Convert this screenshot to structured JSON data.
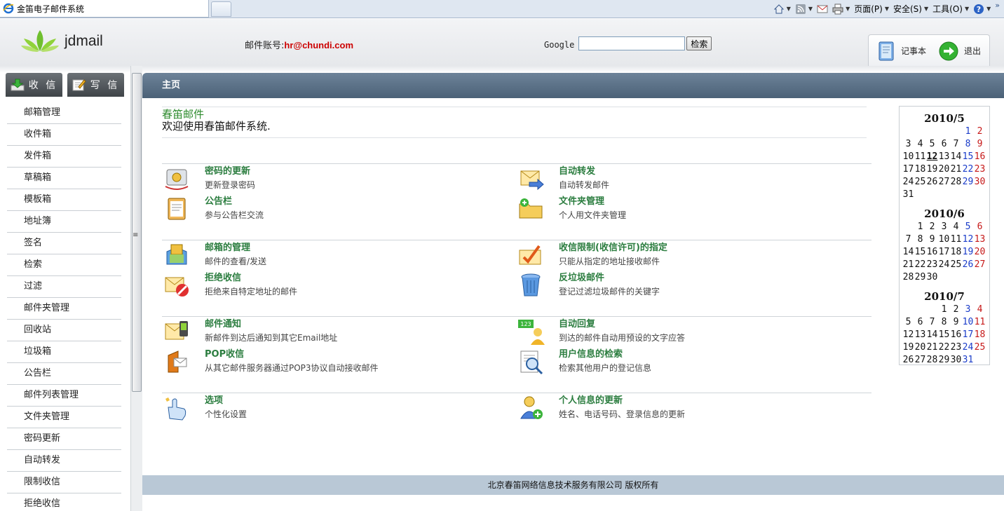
{
  "browser": {
    "tab_title": "金笛电子邮件系统",
    "menu": {
      "page": "页面(P)",
      "safety": "安全(S)",
      "tools": "工具(O)"
    }
  },
  "header": {
    "logo_text": "jdmail",
    "account_label": "邮件账号:",
    "account_value": "hr@chundi.com",
    "google_label": "Google",
    "search_value": "",
    "search_button": "检索",
    "notepad": "记事本",
    "logout": "退出"
  },
  "sidebar": {
    "receive": "收 信",
    "compose": "写 信",
    "items": [
      "邮箱管理",
      "收件箱",
      "发件箱",
      "草稿箱",
      "模板箱",
      "地址簿",
      "签名",
      "检索",
      "过滤",
      "邮件夹管理",
      "回收站",
      "垃圾箱",
      "公告栏",
      "邮件列表管理",
      "文件夹管理",
      "密码更新",
      "自动转发",
      "限制收信",
      "拒绝收信"
    ]
  },
  "main": {
    "title": "主页",
    "welcome_name": "春笛邮件",
    "welcome_msg": "欢迎使用春笛邮件系统.",
    "features": [
      {
        "title": "密码的更新",
        "desc": "更新登录密码",
        "icon": "password-update-icon"
      },
      {
        "title": "自动转发",
        "desc": "自动转发邮件",
        "icon": "auto-forward-icon"
      },
      {
        "title": "公告栏",
        "desc": "参与公告栏交流",
        "icon": "bulletin-board-icon"
      },
      {
        "title": "文件夹管理",
        "desc": "个人用文件夹管理",
        "icon": "folder-management-icon"
      },
      {
        "title": "邮箱的管理",
        "desc": "邮件的查看/发送",
        "icon": "mailbox-management-icon"
      },
      {
        "title": "收信限制(收信许可)的指定",
        "desc": "只能从指定的地址接收邮件",
        "icon": "receive-restriction-icon"
      },
      {
        "title": "拒绝收信",
        "desc": "拒绝来自特定地址的邮件",
        "icon": "reject-mail-icon"
      },
      {
        "title": "反垃圾邮件",
        "desc": "登记过滤垃圾邮件的关键字",
        "icon": "trash-can-icon"
      },
      {
        "title": "邮件通知",
        "desc": "新邮件到达后通知到其它Email地址",
        "icon": "mail-notification-icon"
      },
      {
        "title": "自动回复",
        "desc": "到达的邮件自动用预设的文字应答",
        "icon": "auto-reply-icon"
      },
      {
        "title": "POP收信",
        "desc": "从其它邮件服务器通过POP3协议自动接收邮件",
        "icon": "pop-receive-icon"
      },
      {
        "title": "用户信息的检索",
        "desc": "检索其他用户的登记信息",
        "icon": "user-search-icon"
      },
      {
        "title": "选项",
        "desc": "个性化设置",
        "icon": "options-hand-icon"
      },
      {
        "title": "个人信息的更新",
        "desc": "姓名、电话号码、登录信息的更新",
        "icon": "personal-info-icon"
      }
    ],
    "footer": "北京春笛网络信息技术服务有限公司  版权所有"
  },
  "calendar": {
    "months": [
      {
        "title": "2010/5",
        "weeks": [
          [
            "",
            "",
            "",
            "",
            "",
            "1",
            "2"
          ],
          [
            "3",
            "4",
            "5",
            "6",
            "7",
            "8",
            "9"
          ],
          [
            "10",
            "11",
            "12",
            "13",
            "14",
            "15",
            "16"
          ],
          [
            "17",
            "18",
            "19",
            "20",
            "21",
            "22",
            "23"
          ],
          [
            "24",
            "25",
            "26",
            "27",
            "28",
            "29",
            "30"
          ],
          [
            "31",
            "",
            "",
            "",
            "",
            "",
            ""
          ]
        ],
        "today": "12"
      },
      {
        "title": "2010/6",
        "weeks": [
          [
            "",
            "1",
            "2",
            "3",
            "4",
            "5",
            "6"
          ],
          [
            "7",
            "8",
            "9",
            "10",
            "11",
            "12",
            "13"
          ],
          [
            "14",
            "15",
            "16",
            "17",
            "18",
            "19",
            "20"
          ],
          [
            "21",
            "22",
            "23",
            "24",
            "25",
            "26",
            "27"
          ],
          [
            "28",
            "29",
            "30",
            "",
            "",
            "",
            ""
          ]
        ]
      },
      {
        "title": "2010/7",
        "weeks": [
          [
            "",
            "",
            "",
            "1",
            "2",
            "3",
            "4"
          ],
          [
            "5",
            "6",
            "7",
            "8",
            "9",
            "10",
            "11"
          ],
          [
            "12",
            "13",
            "14",
            "15",
            "16",
            "17",
            "18"
          ],
          [
            "19",
            "20",
            "21",
            "22",
            "23",
            "24",
            "25"
          ],
          [
            "26",
            "27",
            "28",
            "29",
            "30",
            "31",
            ""
          ]
        ]
      }
    ]
  }
}
